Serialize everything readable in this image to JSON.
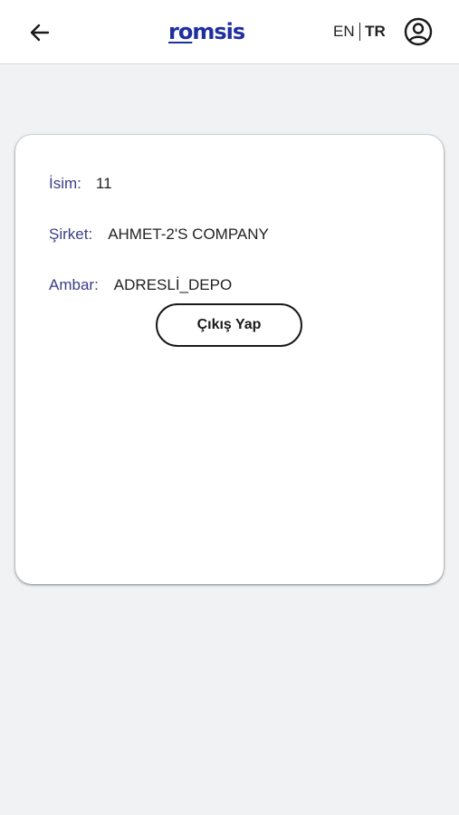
{
  "header": {
    "logo_prefix": "ro",
    "logo_suffix": "msis",
    "lang_en": "EN",
    "lang_tr": "TR",
    "active_lang": "TR"
  },
  "profile": {
    "name_label": "İsim:",
    "name_value": "11",
    "company_label": "Şirket:",
    "company_value": "AHMET-2'S COMPANY",
    "warehouse_label": "Ambar:",
    "warehouse_value": "ADRESLİ_DEPO",
    "logout_label": "Çıkış Yap"
  },
  "icons": {
    "back": "arrow-left-icon",
    "profile": "user-circle-icon"
  },
  "colors": {
    "brand": "#1f2fa0",
    "label": "#3b3f86",
    "background": "#f1f2f4"
  }
}
